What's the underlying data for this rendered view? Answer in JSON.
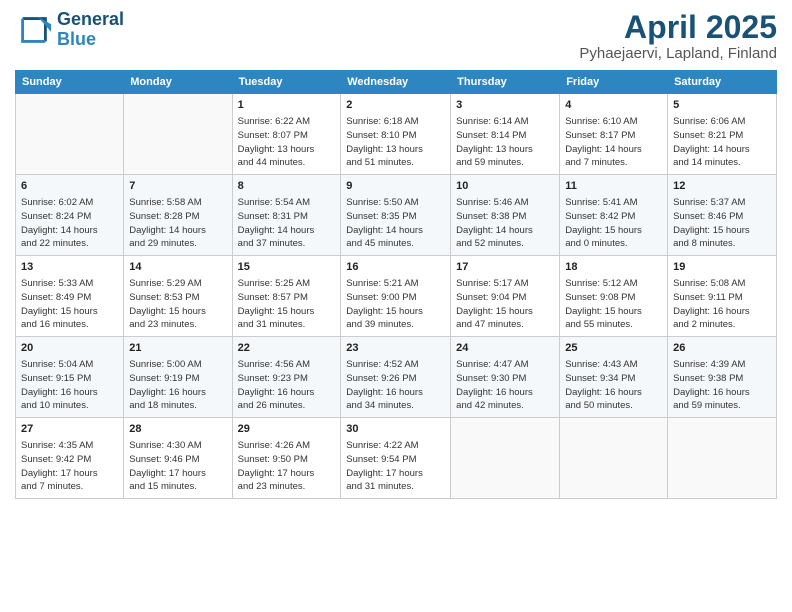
{
  "logo": {
    "line1": "General",
    "line2": "Blue"
  },
  "title": "April 2025",
  "subtitle": "Pyhaejaervi, Lapland, Finland",
  "days_of_week": [
    "Sunday",
    "Monday",
    "Tuesday",
    "Wednesday",
    "Thursday",
    "Friday",
    "Saturday"
  ],
  "weeks": [
    [
      {
        "day": "",
        "content": ""
      },
      {
        "day": "",
        "content": ""
      },
      {
        "day": "1",
        "content": "Sunrise: 6:22 AM\nSunset: 8:07 PM\nDaylight: 13 hours\nand 44 minutes."
      },
      {
        "day": "2",
        "content": "Sunrise: 6:18 AM\nSunset: 8:10 PM\nDaylight: 13 hours\nand 51 minutes."
      },
      {
        "day": "3",
        "content": "Sunrise: 6:14 AM\nSunset: 8:14 PM\nDaylight: 13 hours\nand 59 minutes."
      },
      {
        "day": "4",
        "content": "Sunrise: 6:10 AM\nSunset: 8:17 PM\nDaylight: 14 hours\nand 7 minutes."
      },
      {
        "day": "5",
        "content": "Sunrise: 6:06 AM\nSunset: 8:21 PM\nDaylight: 14 hours\nand 14 minutes."
      }
    ],
    [
      {
        "day": "6",
        "content": "Sunrise: 6:02 AM\nSunset: 8:24 PM\nDaylight: 14 hours\nand 22 minutes."
      },
      {
        "day": "7",
        "content": "Sunrise: 5:58 AM\nSunset: 8:28 PM\nDaylight: 14 hours\nand 29 minutes."
      },
      {
        "day": "8",
        "content": "Sunrise: 5:54 AM\nSunset: 8:31 PM\nDaylight: 14 hours\nand 37 minutes."
      },
      {
        "day": "9",
        "content": "Sunrise: 5:50 AM\nSunset: 8:35 PM\nDaylight: 14 hours\nand 45 minutes."
      },
      {
        "day": "10",
        "content": "Sunrise: 5:46 AM\nSunset: 8:38 PM\nDaylight: 14 hours\nand 52 minutes."
      },
      {
        "day": "11",
        "content": "Sunrise: 5:41 AM\nSunset: 8:42 PM\nDaylight: 15 hours\nand 0 minutes."
      },
      {
        "day": "12",
        "content": "Sunrise: 5:37 AM\nSunset: 8:46 PM\nDaylight: 15 hours\nand 8 minutes."
      }
    ],
    [
      {
        "day": "13",
        "content": "Sunrise: 5:33 AM\nSunset: 8:49 PM\nDaylight: 15 hours\nand 16 minutes."
      },
      {
        "day": "14",
        "content": "Sunrise: 5:29 AM\nSunset: 8:53 PM\nDaylight: 15 hours\nand 23 minutes."
      },
      {
        "day": "15",
        "content": "Sunrise: 5:25 AM\nSunset: 8:57 PM\nDaylight: 15 hours\nand 31 minutes."
      },
      {
        "day": "16",
        "content": "Sunrise: 5:21 AM\nSunset: 9:00 PM\nDaylight: 15 hours\nand 39 minutes."
      },
      {
        "day": "17",
        "content": "Sunrise: 5:17 AM\nSunset: 9:04 PM\nDaylight: 15 hours\nand 47 minutes."
      },
      {
        "day": "18",
        "content": "Sunrise: 5:12 AM\nSunset: 9:08 PM\nDaylight: 15 hours\nand 55 minutes."
      },
      {
        "day": "19",
        "content": "Sunrise: 5:08 AM\nSunset: 9:11 PM\nDaylight: 16 hours\nand 2 minutes."
      }
    ],
    [
      {
        "day": "20",
        "content": "Sunrise: 5:04 AM\nSunset: 9:15 PM\nDaylight: 16 hours\nand 10 minutes."
      },
      {
        "day": "21",
        "content": "Sunrise: 5:00 AM\nSunset: 9:19 PM\nDaylight: 16 hours\nand 18 minutes."
      },
      {
        "day": "22",
        "content": "Sunrise: 4:56 AM\nSunset: 9:23 PM\nDaylight: 16 hours\nand 26 minutes."
      },
      {
        "day": "23",
        "content": "Sunrise: 4:52 AM\nSunset: 9:26 PM\nDaylight: 16 hours\nand 34 minutes."
      },
      {
        "day": "24",
        "content": "Sunrise: 4:47 AM\nSunset: 9:30 PM\nDaylight: 16 hours\nand 42 minutes."
      },
      {
        "day": "25",
        "content": "Sunrise: 4:43 AM\nSunset: 9:34 PM\nDaylight: 16 hours\nand 50 minutes."
      },
      {
        "day": "26",
        "content": "Sunrise: 4:39 AM\nSunset: 9:38 PM\nDaylight: 16 hours\nand 59 minutes."
      }
    ],
    [
      {
        "day": "27",
        "content": "Sunrise: 4:35 AM\nSunset: 9:42 PM\nDaylight: 17 hours\nand 7 minutes."
      },
      {
        "day": "28",
        "content": "Sunrise: 4:30 AM\nSunset: 9:46 PM\nDaylight: 17 hours\nand 15 minutes."
      },
      {
        "day": "29",
        "content": "Sunrise: 4:26 AM\nSunset: 9:50 PM\nDaylight: 17 hours\nand 23 minutes."
      },
      {
        "day": "30",
        "content": "Sunrise: 4:22 AM\nSunset: 9:54 PM\nDaylight: 17 hours\nand 31 minutes."
      },
      {
        "day": "",
        "content": ""
      },
      {
        "day": "",
        "content": ""
      },
      {
        "day": "",
        "content": ""
      }
    ]
  ]
}
